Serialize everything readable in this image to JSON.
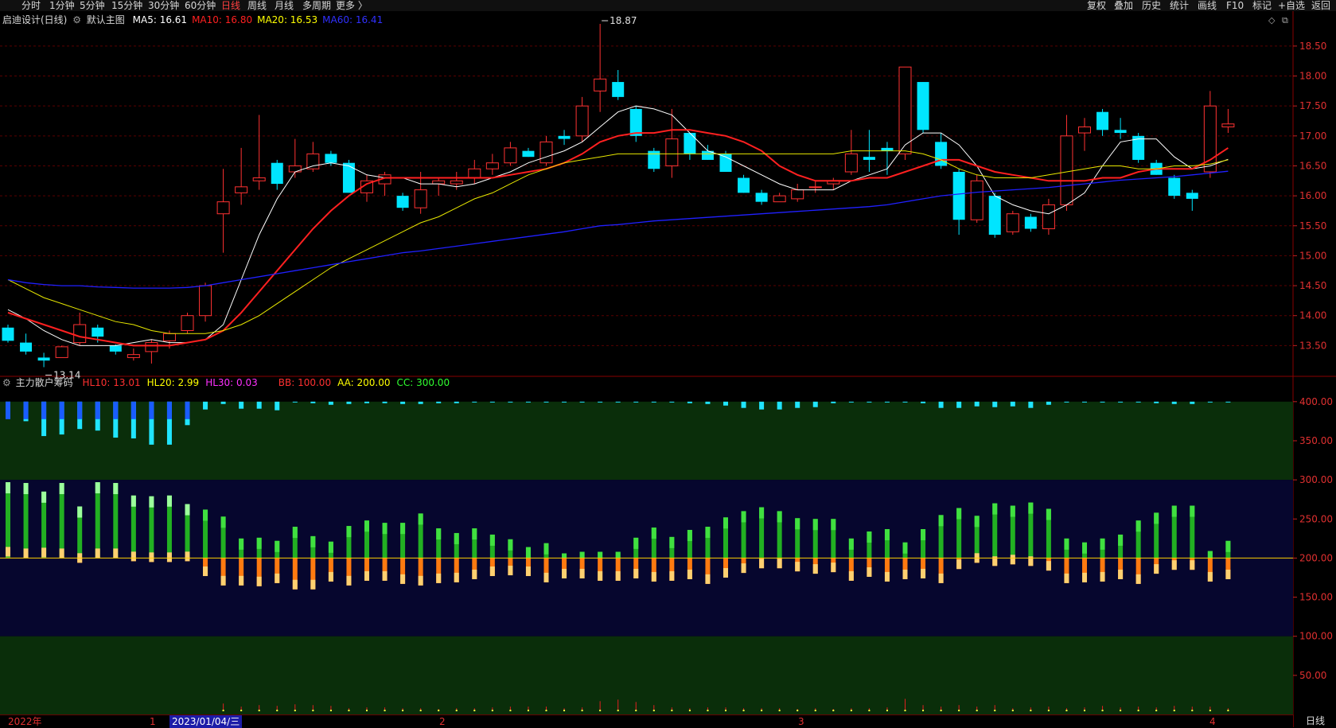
{
  "toolbar": {
    "periods": [
      {
        "label": "分时",
        "active": false
      },
      {
        "label": "1分钟",
        "active": false
      },
      {
        "label": "5分钟",
        "active": false
      },
      {
        "label": "15分钟",
        "active": false
      },
      {
        "label": "30分钟",
        "active": false
      },
      {
        "label": "60分钟",
        "active": false
      },
      {
        "label": "日线",
        "active": true
      },
      {
        "label": "周线",
        "active": false
      },
      {
        "label": "月线",
        "active": false
      },
      {
        "label": "多周期",
        "active": false
      },
      {
        "label": "更多 〉",
        "active": false
      }
    ],
    "right": [
      "复权",
      "叠加",
      "历史",
      "统计",
      "画线",
      "F10",
      "标记",
      "+自选",
      "返回"
    ]
  },
  "main_header": {
    "title": "启迪设计(日线)",
    "template": "默认主图",
    "ma": [
      {
        "label": "MA5: 16.61",
        "color": "#ffffff"
      },
      {
        "label": "MA10: 16.80",
        "color": "#ff2020"
      },
      {
        "label": "MA20: 16.53",
        "color": "#ffff00"
      },
      {
        "label": "MA60: 16.41",
        "color": "#3030ff"
      }
    ]
  },
  "sub_header": {
    "title": "主力散户筹码",
    "params": [
      {
        "label": "HL10: 13.01",
        "color": "#ff3030"
      },
      {
        "label": "HL20: 2.99",
        "color": "#ffff00"
      },
      {
        "label": "HL30: 0.03",
        "color": "#ff30ff"
      },
      {
        "label": "BB: 100.00",
        "color": "#ff3030"
      },
      {
        "label": "AA: 200.00",
        "color": "#ffff00"
      },
      {
        "label": "CC: 300.00",
        "color": "#30ff30"
      }
    ]
  },
  "bottom": {
    "year_label": "2022年",
    "cursor_date": "2023/01/04/三",
    "month_marks": [
      "1",
      "2",
      "3",
      "4"
    ],
    "period": "日线"
  },
  "colors": {
    "up": "#ff3232",
    "down": "#00e5ff",
    "ma5": "#ffffff",
    "ma10": "#ff2020",
    "ma20": "#e8e800",
    "ma60": "#2020ff",
    "grid": "#5a0000",
    "zone_green": "#0a2e0a",
    "zone_blue": "#06062e"
  },
  "chart_data": [
    {
      "type": "candlestick",
      "title": "启迪设计(日线)",
      "y_ticks": [
        13.5,
        14.0,
        14.5,
        15.0,
        15.5,
        16.0,
        16.5,
        17.0,
        17.5,
        18.0,
        18.5
      ],
      "ylim": [
        13.0,
        18.95
      ],
      "annotations": [
        {
          "label": "18.87",
          "value": 18.87,
          "bar_index": 33
        },
        {
          "label": "13.14",
          "value": 13.14,
          "bar_index": 2
        }
      ],
      "ohlc": [
        [
          13.8,
          13.85,
          13.55,
          13.58
        ],
        [
          13.55,
          13.7,
          13.35,
          13.4
        ],
        [
          13.3,
          13.38,
          13.14,
          13.25
        ],
        [
          13.3,
          13.5,
          13.3,
          13.48
        ],
        [
          13.55,
          14.05,
          13.5,
          13.85
        ],
        [
          13.8,
          13.85,
          13.55,
          13.65
        ],
        [
          13.5,
          13.52,
          13.35,
          13.4
        ],
        [
          13.3,
          13.45,
          13.25,
          13.35
        ],
        [
          13.4,
          13.6,
          13.2,
          13.55
        ],
        [
          13.58,
          13.75,
          13.45,
          13.7
        ],
        [
          13.75,
          14.05,
          13.7,
          14.0
        ],
        [
          14.0,
          14.55,
          13.9,
          14.5
        ],
        [
          15.7,
          16.45,
          15.05,
          15.9
        ],
        [
          16.05,
          16.8,
          15.85,
          16.15
        ],
        [
          16.25,
          17.35,
          16.1,
          16.3
        ],
        [
          16.55,
          16.6,
          16.1,
          16.2
        ],
        [
          16.4,
          16.95,
          16.3,
          16.5
        ],
        [
          16.45,
          16.9,
          16.4,
          16.7
        ],
        [
          16.7,
          16.75,
          16.5,
          16.55
        ],
        [
          16.55,
          16.6,
          16.1,
          16.05
        ],
        [
          16.05,
          16.35,
          15.9,
          16.25
        ],
        [
          16.2,
          16.4,
          16.0,
          16.35
        ],
        [
          16.0,
          16.05,
          15.75,
          15.8
        ],
        [
          15.8,
          16.4,
          15.7,
          16.1
        ],
        [
          16.2,
          16.3,
          16.0,
          16.25
        ],
        [
          16.2,
          16.4,
          16.1,
          16.25
        ],
        [
          16.3,
          16.6,
          16.2,
          16.45
        ],
        [
          16.45,
          16.7,
          16.35,
          16.55
        ],
        [
          16.55,
          16.9,
          16.5,
          16.8
        ],
        [
          16.75,
          16.8,
          16.65,
          16.65
        ],
        [
          16.55,
          17.0,
          16.5,
          16.9
        ],
        [
          17.0,
          17.1,
          16.85,
          16.95
        ],
        [
          17.0,
          17.65,
          16.9,
          17.5
        ],
        [
          17.75,
          18.87,
          17.4,
          17.95
        ],
        [
          17.9,
          18.1,
          17.6,
          17.65
        ],
        [
          17.45,
          17.5,
          16.9,
          17.0
        ],
        [
          16.75,
          16.8,
          16.4,
          16.45
        ],
        [
          16.5,
          17.45,
          16.3,
          16.95
        ],
        [
          17.05,
          17.05,
          16.6,
          16.7
        ],
        [
          16.75,
          16.85,
          16.6,
          16.6
        ],
        [
          16.7,
          16.75,
          16.4,
          16.4
        ],
        [
          16.3,
          16.35,
          16.05,
          16.05
        ],
        [
          16.05,
          16.1,
          15.85,
          15.9
        ],
        [
          15.9,
          16.05,
          15.9,
          16.0
        ],
        [
          15.95,
          16.2,
          15.9,
          16.1
        ],
        [
          16.15,
          16.25,
          16.05,
          16.15
        ],
        [
          16.2,
          16.3,
          16.1,
          16.25
        ],
        [
          16.4,
          17.1,
          16.35,
          16.7
        ],
        [
          16.65,
          17.1,
          16.4,
          16.6
        ],
        [
          16.8,
          16.9,
          16.35,
          16.75
        ],
        [
          16.7,
          18.15,
          16.6,
          18.15
        ],
        [
          17.9,
          17.9,
          17.05,
          17.1
        ],
        [
          16.9,
          17.05,
          16.45,
          16.5
        ],
        [
          16.4,
          16.45,
          15.35,
          15.6
        ],
        [
          15.6,
          16.35,
          15.55,
          16.25
        ],
        [
          16.0,
          16.05,
          15.3,
          15.35
        ],
        [
          15.4,
          15.75,
          15.35,
          15.7
        ],
        [
          15.65,
          15.7,
          15.4,
          15.45
        ],
        [
          15.45,
          15.95,
          15.35,
          15.85
        ],
        [
          15.85,
          17.35,
          15.75,
          17.0
        ],
        [
          17.05,
          17.3,
          16.75,
          17.15
        ],
        [
          17.4,
          17.45,
          17.0,
          17.1
        ],
        [
          17.1,
          17.3,
          16.95,
          17.05
        ],
        [
          17.0,
          17.05,
          16.55,
          16.6
        ],
        [
          16.55,
          16.6,
          16.35,
          16.35
        ],
        [
          16.3,
          16.35,
          15.95,
          16.0
        ],
        [
          16.05,
          16.1,
          15.75,
          15.95
        ],
        [
          16.4,
          17.75,
          16.3,
          17.5
        ],
        [
          17.15,
          17.45,
          17.05,
          17.2
        ]
      ],
      "ma_series": {
        "MA5": [
          14.1,
          13.95,
          13.75,
          13.6,
          13.5,
          13.5,
          13.5,
          13.55,
          13.6,
          13.55,
          13.55,
          13.6,
          13.85,
          14.6,
          15.35,
          15.95,
          16.4,
          16.5,
          16.55,
          16.5,
          16.35,
          16.3,
          16.3,
          16.2,
          16.2,
          16.15,
          16.2,
          16.3,
          16.4,
          16.55,
          16.65,
          16.75,
          16.9,
          17.15,
          17.4,
          17.5,
          17.45,
          17.35,
          17.05,
          16.75,
          16.65,
          16.5,
          16.35,
          16.2,
          16.1,
          16.1,
          16.1,
          16.25,
          16.35,
          16.45,
          16.85,
          17.05,
          17.05,
          16.85,
          16.5,
          16.0,
          15.85,
          15.75,
          15.7,
          15.85,
          16.05,
          16.5,
          16.9,
          16.95,
          16.95,
          16.65,
          16.45,
          16.5,
          16.61
        ],
        "MA10": [
          14.05,
          13.95,
          13.85,
          13.75,
          13.65,
          13.6,
          13.55,
          13.5,
          13.5,
          13.5,
          13.55,
          13.6,
          13.75,
          14.05,
          14.4,
          14.75,
          15.1,
          15.45,
          15.75,
          16.0,
          16.2,
          16.3,
          16.3,
          16.3,
          16.3,
          16.3,
          16.3,
          16.3,
          16.35,
          16.4,
          16.45,
          16.55,
          16.7,
          16.9,
          17.0,
          17.05,
          17.05,
          17.1,
          17.1,
          17.05,
          17.0,
          16.9,
          16.75,
          16.5,
          16.35,
          16.25,
          16.25,
          16.25,
          16.3,
          16.3,
          16.4,
          16.5,
          16.6,
          16.6,
          16.5,
          16.4,
          16.35,
          16.3,
          16.25,
          16.25,
          16.25,
          16.3,
          16.3,
          16.4,
          16.45,
          16.45,
          16.45,
          16.6,
          16.8
        ],
        "MA20": [
          14.6,
          14.45,
          14.3,
          14.2,
          14.1,
          14.0,
          13.9,
          13.85,
          13.75,
          13.7,
          13.7,
          13.7,
          13.75,
          13.85,
          14.0,
          14.2,
          14.4,
          14.6,
          14.8,
          14.95,
          15.1,
          15.25,
          15.4,
          15.55,
          15.65,
          15.8,
          15.95,
          16.05,
          16.2,
          16.35,
          16.45,
          16.55,
          16.6,
          16.65,
          16.7,
          16.7,
          16.7,
          16.7,
          16.7,
          16.7,
          16.7,
          16.7,
          16.7,
          16.7,
          16.7,
          16.7,
          16.7,
          16.75,
          16.75,
          16.75,
          16.75,
          16.7,
          16.6,
          16.45,
          16.35,
          16.3,
          16.3,
          16.3,
          16.35,
          16.4,
          16.45,
          16.5,
          16.5,
          16.45,
          16.45,
          16.5,
          16.5,
          16.53,
          16.6
        ],
        "MA60": [
          14.6,
          14.55,
          14.52,
          14.5,
          14.5,
          14.48,
          14.47,
          14.46,
          14.46,
          14.46,
          14.47,
          14.5,
          14.55,
          14.6,
          14.65,
          14.7,
          14.75,
          14.8,
          14.85,
          14.9,
          14.95,
          15.0,
          15.05,
          15.08,
          15.12,
          15.16,
          15.2,
          15.24,
          15.28,
          15.32,
          15.36,
          15.4,
          15.45,
          15.5,
          15.52,
          15.55,
          15.58,
          15.6,
          15.62,
          15.64,
          15.66,
          15.68,
          15.7,
          15.72,
          15.74,
          15.76,
          15.78,
          15.8,
          15.82,
          15.85,
          15.9,
          15.95,
          16.0,
          16.03,
          16.06,
          16.08,
          16.1,
          16.12,
          16.14,
          16.17,
          16.2,
          16.23,
          16.26,
          16.28,
          16.3,
          16.32,
          16.35,
          16.38,
          16.41
        ]
      }
    },
    {
      "type": "bar",
      "title": "主力散户筹码",
      "y_ticks": [
        50,
        100,
        150,
        200,
        250,
        300,
        350,
        400
      ],
      "ylim": [
        0,
        410
      ],
      "zones": {
        "bb": 100,
        "aa": 200,
        "cc": 300
      },
      "series": [
        {
          "name": "HL10",
          "values": [
            297,
            296,
            285,
            296,
            266,
            297,
            296,
            280,
            279,
            280,
            269,
            262,
            253,
            225,
            226,
            222,
            240,
            228,
            221,
            241,
            248,
            245,
            245,
            257,
            238,
            232,
            238,
            230,
            224,
            214,
            219,
            206,
            208,
            208,
            208,
            226,
            239,
            227,
            236,
            240,
            252,
            260,
            265,
            260,
            251,
            250,
            250,
            225,
            234,
            237,
            220,
            237,
            255,
            264,
            254,
            270,
            267,
            271,
            263,
            225,
            220,
            225,
            230,
            248,
            258,
            267,
            267,
            209,
            222
          ]
        },
        {
          "name": "HL20",
          "values": [
            202,
            200,
            201,
            200,
            194,
            200,
            200,
            196,
            195,
            195,
            196,
            177,
            165,
            165,
            164,
            168,
            160,
            160,
            170,
            165,
            171,
            171,
            167,
            165,
            168,
            169,
            173,
            177,
            178,
            177,
            169,
            174,
            174,
            171,
            171,
            174,
            170,
            171,
            173,
            167,
            175,
            181,
            187,
            187,
            183,
            180,
            182,
            171,
            176,
            170,
            173,
            174,
            168,
            186,
            194,
            190,
            192,
            190,
            184,
            168,
            169,
            170,
            173,
            167,
            180,
            185,
            185,
            170,
            173
          ]
        },
        {
          "name": "HL30",
          "values": [
            385,
            375,
            356,
            358,
            365,
            363,
            354,
            353,
            345,
            345,
            370,
            390,
            397,
            391,
            391,
            389,
            400,
            398,
            396,
            397,
            398,
            398,
            397,
            397,
            398,
            398,
            399,
            399,
            400,
            400,
            400,
            400,
            400,
            400,
            400,
            400,
            400,
            400,
            398,
            397,
            395,
            392,
            390,
            390,
            392,
            393,
            398,
            400,
            400,
            400,
            400,
            398,
            392,
            392,
            394,
            393,
            394,
            392,
            396,
            399,
            400,
            400,
            400,
            399,
            398,
            397,
            397,
            399,
            400
          ]
        },
        {
          "name": "SMALL",
          "values": [
            0,
            0,
            0,
            0,
            0,
            0,
            0,
            0,
            0,
            0,
            0,
            0,
            14,
            10,
            12,
            11,
            13,
            12,
            11,
            8,
            9,
            9,
            8,
            8,
            7,
            8,
            8,
            9,
            10,
            10,
            10,
            8,
            9,
            17,
            19,
            16,
            12,
            9,
            8,
            9,
            9,
            8,
            8,
            8,
            7,
            8,
            7,
            8,
            8,
            9,
            20,
            12,
            10,
            12,
            10,
            12,
            8,
            9,
            10,
            8,
            9,
            11,
            9,
            10,
            9,
            11,
            10,
            10,
            8
          ]
        }
      ]
    }
  ]
}
